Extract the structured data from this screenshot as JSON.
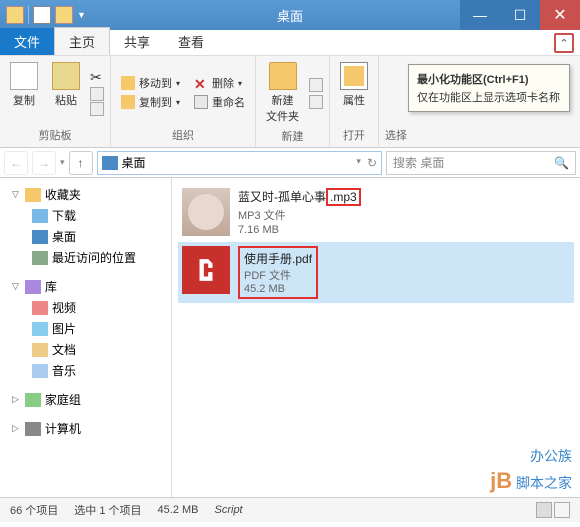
{
  "window": {
    "title": "桌面"
  },
  "tabs": {
    "file": "文件",
    "home": "主页",
    "share": "共享",
    "view": "查看"
  },
  "ribbon": {
    "clipboard": {
      "label": "剪贴板",
      "copy": "复制",
      "paste": "粘贴"
    },
    "organize": {
      "label": "组织",
      "moveto": "移动到",
      "copyto": "复制到",
      "delete": "删除",
      "rename": "重命名"
    },
    "new": {
      "label": "新建",
      "newfolder": "新建\n文件夹"
    },
    "open": {
      "label": "打开",
      "properties": "属性"
    },
    "select": {
      "label": "选择"
    }
  },
  "tooltip": {
    "title": "最小化功能区(Ctrl+F1)",
    "body": "仅在功能区上显示选项卡名称"
  },
  "nav": {
    "location": "桌面",
    "search_placeholder": "搜索 桌面"
  },
  "tree": {
    "favorites": "收藏夹",
    "downloads": "下载",
    "desktop": "桌面",
    "recent": "最近访问的位置",
    "libraries": "库",
    "videos": "视频",
    "pictures": "图片",
    "documents": "文档",
    "music": "音乐",
    "homegroup": "家庭组",
    "computer": "计算机"
  },
  "files": [
    {
      "name_base": "蓝又时-孤单心事",
      "name_ext": ".mp3",
      "type": "MP3 文件",
      "size": "7.16 MB"
    },
    {
      "name_base": "使用手册",
      "name_ext": ".pdf",
      "type": "PDF 文件",
      "size": "45.2 MB"
    }
  ],
  "status": {
    "count": "66 个项目",
    "selection": "选中 1 个项目",
    "size": "45.2 MB",
    "script": "Script"
  },
  "watermark": {
    "line1": "办公族",
    "line2": "脚本之家"
  }
}
